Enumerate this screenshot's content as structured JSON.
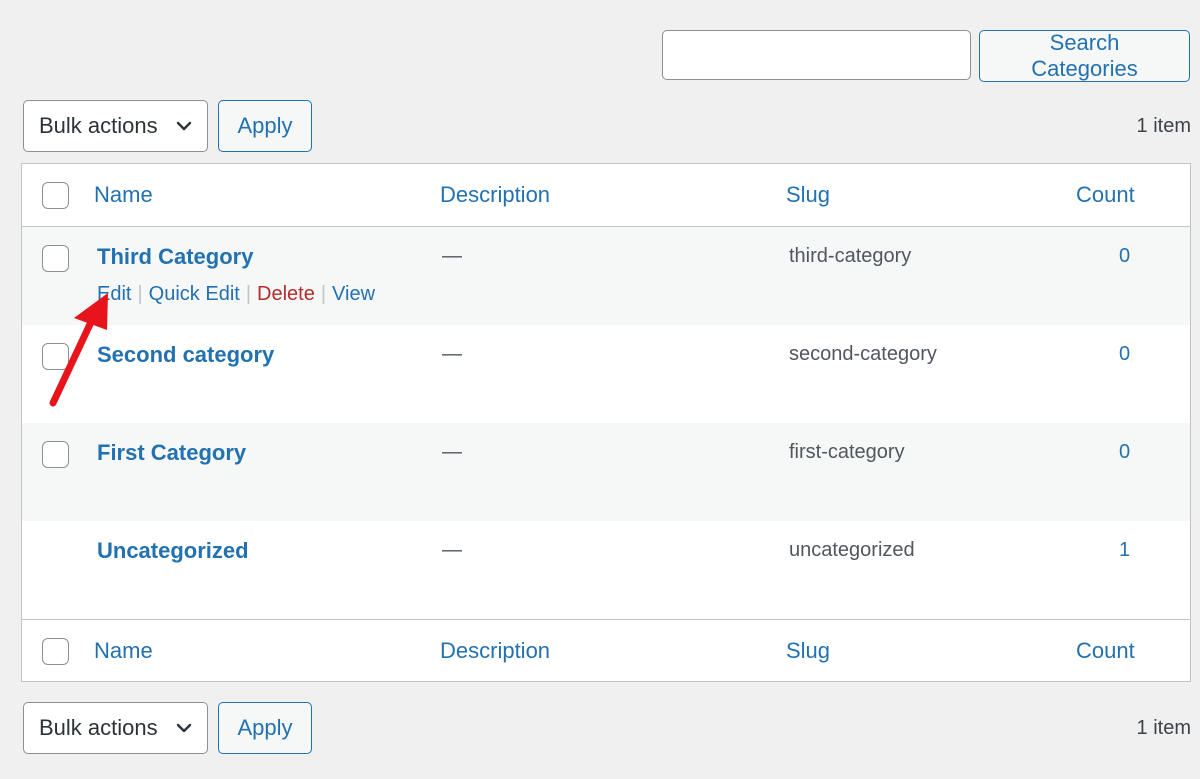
{
  "search": {
    "input_value": "",
    "placeholder": "",
    "button_label": "Search Categories"
  },
  "tablenav_top": {
    "bulk_select_value": "Bulk actions",
    "apply_label": "Apply",
    "items_count": "1 item"
  },
  "tablenav_bottom": {
    "bulk_select_value": "Bulk actions",
    "apply_label": "Apply",
    "items_count": "1 item"
  },
  "table": {
    "columns": [
      "Name",
      "Description",
      "Slug",
      "Count"
    ],
    "rows": [
      {
        "name": "Third Category",
        "description": "—",
        "slug": "third-category",
        "count": "0",
        "has_checkbox": true,
        "row_actions": [
          "Edit",
          "Quick Edit",
          "Delete",
          "View"
        ]
      },
      {
        "name": "Second category",
        "description": "—",
        "slug": "second-category",
        "count": "0",
        "has_checkbox": true
      },
      {
        "name": "First Category",
        "description": "—",
        "slug": "first-category",
        "count": "0",
        "has_checkbox": true
      },
      {
        "name": "Uncategorized",
        "description": "—",
        "slug": "uncategorized",
        "count": "1",
        "has_checkbox": false
      }
    ]
  },
  "annotation": {
    "arrow_color": "#e8141b",
    "points_to": "Edit"
  },
  "colors": {
    "link": "#2271b1",
    "delete": "#b32d2e",
    "background": "#f0f0f1"
  }
}
